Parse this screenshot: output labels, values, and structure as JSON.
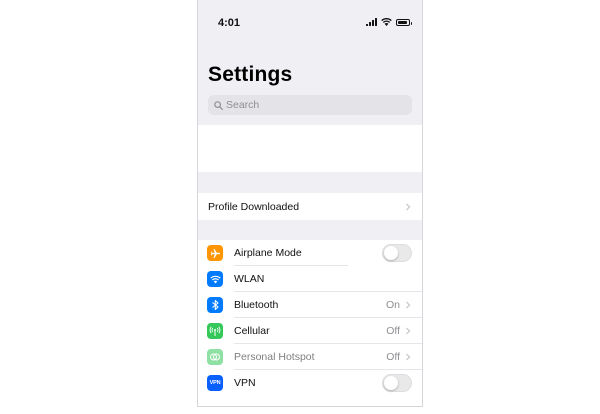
{
  "status_bar": {
    "time": "4:01",
    "battery_level": 0.9
  },
  "page_title": "Settings",
  "search": {
    "placeholder": "Search"
  },
  "profile": {
    "label": "Profile Downloaded"
  },
  "settings": [
    {
      "id": "airplane",
      "label": "Airplane Mode",
      "icon": "airplane-icon",
      "color": "#ff9500",
      "control": "toggle",
      "value": "",
      "on": false
    },
    {
      "id": "wlan",
      "label": "WLAN",
      "icon": "wifi-icon",
      "color": "#007aff",
      "control": "none",
      "value": ""
    },
    {
      "id": "bluetooth",
      "label": "Bluetooth",
      "icon": "bluetooth-icon",
      "color": "#007aff",
      "control": "chevron",
      "value": "On"
    },
    {
      "id": "cellular",
      "label": "Cellular",
      "icon": "cellular-icon",
      "color": "#34c759",
      "control": "chevron",
      "value": "Off"
    },
    {
      "id": "hotspot",
      "label": "Personal Hotspot",
      "icon": "hotspot-icon",
      "color": "#34c759",
      "control": "chevron",
      "value": "Off",
      "disabled": true
    },
    {
      "id": "vpn",
      "label": "VPN",
      "icon": "vpn-icon",
      "icon_text": "VPN",
      "color": "#0a60ff",
      "control": "toggle",
      "value": "",
      "on": false
    }
  ]
}
